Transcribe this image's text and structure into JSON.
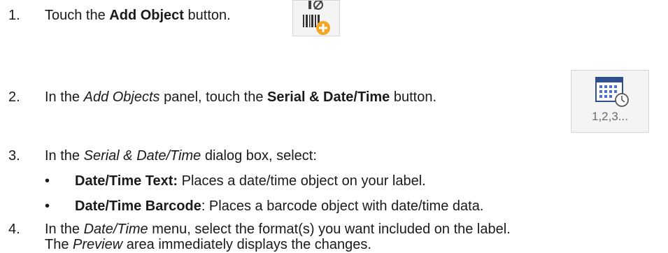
{
  "steps": [
    {
      "number": "1.",
      "pre": "Touch the ",
      "bold": "Add Object",
      "post": " button."
    },
    {
      "number": "2.",
      "pre": "In the ",
      "italic": "Add Objects",
      "mid": " panel, touch the ",
      "bold": "Serial & Date/Time",
      "post": " button."
    },
    {
      "number": "3.",
      "pre": "In the ",
      "italic": "Serial & Date/Time",
      "post": " dialog box, select:",
      "bullets": [
        {
          "bullet": "•",
          "bold": "Date/Time Text:",
          "text": " Places a date/time object on your label."
        },
        {
          "bullet": "•",
          "bold": "Date/Time Barcode",
          "text": ": Places a barcode object with date/time data."
        }
      ]
    },
    {
      "number": "4.",
      "pre": "In the ",
      "italic": "Date/Time",
      "post": " menu, select the format(s) you want included on the label.",
      "line2_pre": "The ",
      "line2_italic": "Preview",
      "line2_post": " area immediately displays the changes."
    }
  ],
  "icons": {
    "add_object": "add-object-barcode-icon",
    "serial_date_time": "serial-date-time-icon",
    "serial_label": "1,2,3...",
    "colors": {
      "plus_badge": "#f5a623",
      "calendar_header": "#2f4f8f",
      "grid": "#4a6fd0",
      "clock": "#555555"
    }
  }
}
